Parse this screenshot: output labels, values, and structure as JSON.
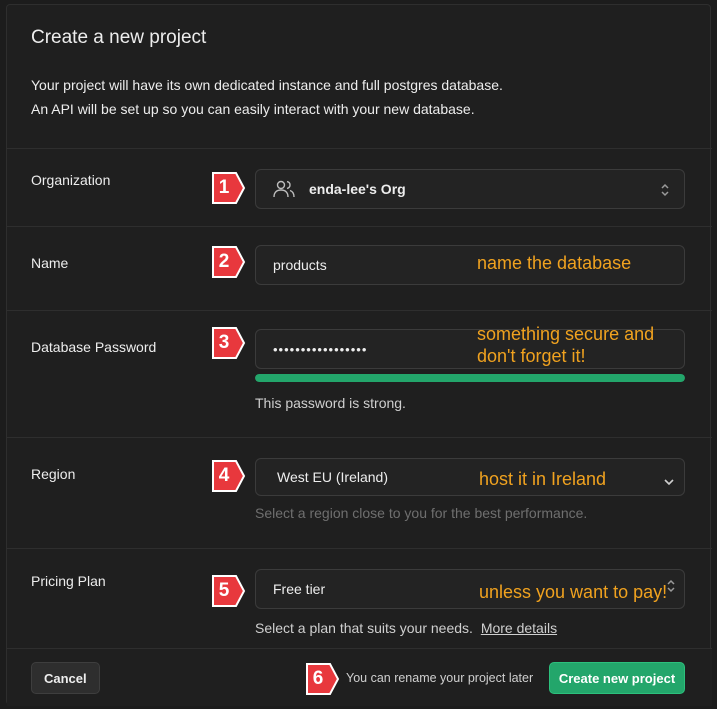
{
  "dialog": {
    "title": "Create a new project",
    "description_line1": "Your project will have its own dedicated instance and full postgres database.",
    "description_line2": "An API will be set up so you can easily interact with your new database."
  },
  "organization": {
    "label": "Organization",
    "value": "enda-lee's Org",
    "badge": "1"
  },
  "name": {
    "label": "Name",
    "value": "products",
    "note": "name the database",
    "badge": "2"
  },
  "password": {
    "label": "Database Password",
    "value": "•••••••••••••••••",
    "note_line1": "something secure and",
    "note_line2": "don't forget it!",
    "strength_text": "This password is strong.",
    "strength_fraction": 1.0,
    "strength_color": "#23a66b",
    "badge": "3"
  },
  "region": {
    "label": "Region",
    "value": "West EU (Ireland)",
    "note": "host it in Ireland",
    "hint": "Select a region close to you for the best performance.",
    "badge": "4"
  },
  "pricing": {
    "label": "Pricing Plan",
    "value": "Free tier",
    "note": "unless you want to pay!",
    "hint": "Select a plan that suits your needs.",
    "hint_link": "More details",
    "badge": "5"
  },
  "footer": {
    "cancel_label": "Cancel",
    "rename_note": "You can rename your project later",
    "create_label": "Create new project",
    "badge": "6"
  },
  "colors": {
    "accent": "#23a66b",
    "annotation": "#f0a21f",
    "badge_red": "#e8383d"
  }
}
